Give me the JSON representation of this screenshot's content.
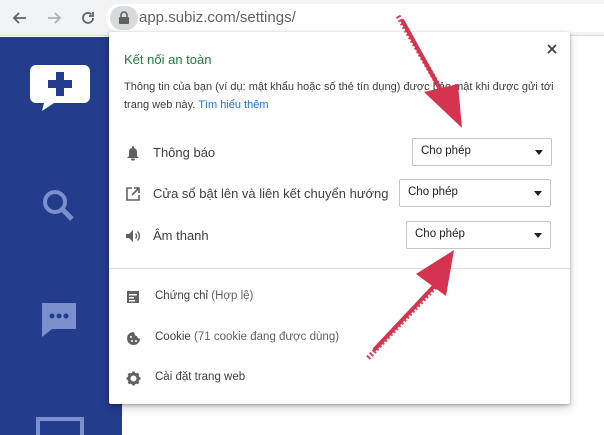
{
  "browser": {
    "url": "app.subiz.com/settings/",
    "icons": {
      "back": "arrow-left-icon",
      "forward": "arrow-right-icon",
      "reload": "reload-icon",
      "lock": "lock-icon"
    }
  },
  "sidebar": {
    "icons": [
      "chat-plus-icon",
      "search-icon",
      "message-icon",
      "list-icon"
    ]
  },
  "popup": {
    "title": "Kết nối an toàn",
    "description": "Thông tin của bạn (ví dụ: mật khẩu hoặc số thẻ tín dụng) được bảo mật khi được gửi tới trang web này.",
    "learn_more": "Tìm hiểu thêm",
    "permissions": [
      {
        "icon": "bell-icon",
        "label": "Thông báo",
        "value": "Cho phép"
      },
      {
        "icon": "popup-icon",
        "label": "Cửa sổ bật lên và liên kết chuyển hướng",
        "value": "Cho phép"
      },
      {
        "icon": "speaker-icon",
        "label": "Âm thanh",
        "value": "Cho phép"
      }
    ],
    "info_items": [
      {
        "icon": "certificate-icon",
        "label": "Chứng chỉ",
        "sub": "(Hợp lệ)"
      },
      {
        "icon": "cookie-icon",
        "label": "Cookie",
        "sub": "(71 cookie đang được dùng)"
      },
      {
        "icon": "gear-icon",
        "label": "Cài đặt trang web",
        "sub": ""
      }
    ]
  },
  "colors": {
    "sidebar": "#233c8c",
    "title_green": "#188038",
    "link_blue": "#1a73e8",
    "annotation_arrow": "#d6334e"
  }
}
